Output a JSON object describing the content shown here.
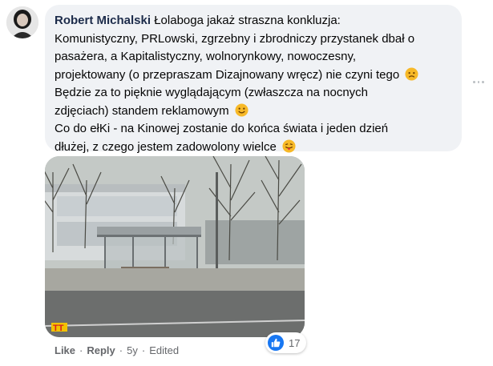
{
  "comment": {
    "author": "Robert Michalski",
    "lines": [
      "Łolaboga jakaż straszna konkluzja:",
      "Komunistyczny, PRLowski, zgrzebny i zbrodniczy przystanek dbał o",
      "pasażera, a Kapitalistyczny, wolnorynkowy, nowoczesny,",
      "projektowany (o przepraszam Dizajnowany wręcz) nie czyni tego",
      "Będzie za to pięknie wyglądającym (zwłaszcza na nocnych",
      "zdjęciach) standem reklamowym",
      "Co do ełKi - na Kinowej zostanie do końca świata i jeden dzień",
      "dłużej, z czego jestem zadowolony wielce"
    ],
    "emojis": [
      "frowning-face-emoji",
      "smiling-face-emoji",
      "tongue-out-emoji"
    ]
  },
  "actions": {
    "like": "Like",
    "reply": "Reply",
    "separator": "·",
    "time": "5y",
    "edited": "Edited"
  },
  "reactions": {
    "icon": "thumbs-up-icon",
    "count": "17"
  },
  "colors": {
    "bubble": "#f0f2f5",
    "author": "#1c2b4a",
    "meta": "#65676b",
    "like_blue": "#1877f2"
  }
}
